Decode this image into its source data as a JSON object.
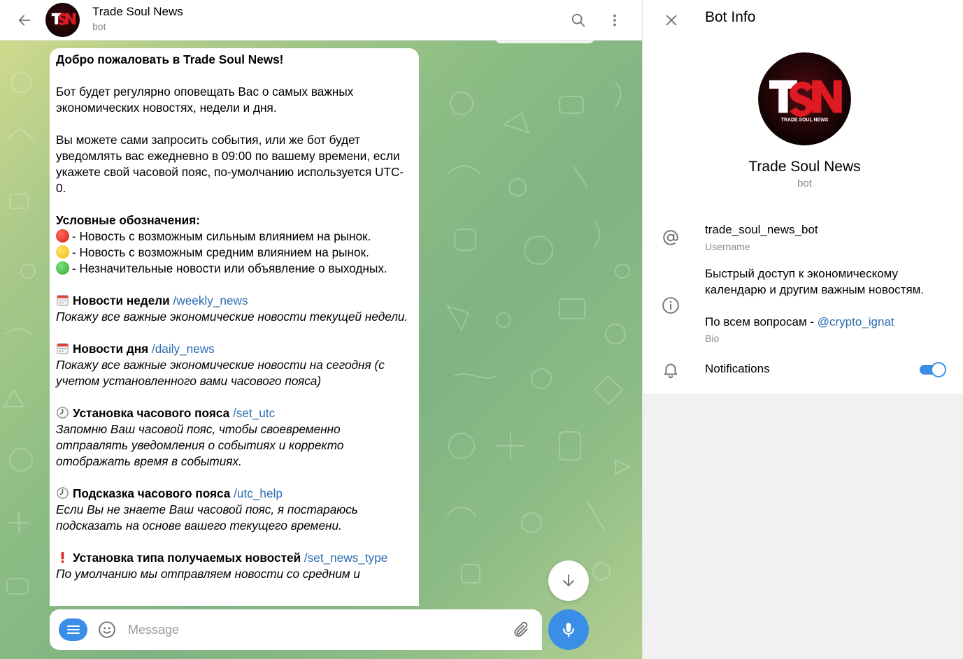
{
  "header": {
    "title": "Trade Soul News",
    "subtitle": "bot"
  },
  "message": {
    "welcome": "Добро пожаловать в Trade Soul News!",
    "intro": "Бот будет регулярно оповещать Вас о самых важных экономических новостях, недели и дня.",
    "schedule": "Вы можете сами запросить события, или же бот будет уведомлять вас ежедневно в 09:00 по вашему времени, если укажете свой часовой пояс, по-умолчанию используется UTC-0.",
    "legend_title": "Условные обозначения:",
    "legend_red": "- Новость с возможным сильным влиянием на рынок.",
    "legend_yellow": "- Новость с возможным средним влиянием на рынок.",
    "legend_green": "- Незначительные новости или объявление о выходных.",
    "commands": [
      {
        "title": "Новости недели",
        "cmd": "/weekly_news",
        "desc": "Покажу все важные экономические новости текущей недели."
      },
      {
        "title": "Новости дня",
        "cmd": "/daily_news",
        "desc": "Покажу все важные экономические новости на сегодня (с учетом установленного вами часового пояса)"
      },
      {
        "title": "Установка часового пояса",
        "cmd": "/set_utc",
        "desc": "Запомню Ваш часовой пояс, чтобы своевременно отправлять уведомления о событиях и корректо отображать время в событиях."
      },
      {
        "title": "Подсказка часового пояса",
        "cmd": "/utc_help",
        "desc": "Если Вы не знаете Ваш часовой пояс, я постараюсь подсказать на основе вашего текущего времени."
      },
      {
        "title": "Установка типа получаемых новостей",
        "cmd": "/set_news_type",
        "desc": "По умолчанию мы отправляем новости со средним и"
      }
    ],
    "icons": [
      "calendar-icon",
      "calendar-icon",
      "clock-icon",
      "clock-icon",
      "exclamation-icon"
    ]
  },
  "composer": {
    "placeholder": "Message"
  },
  "panel": {
    "title": "Bot Info",
    "bot_name": "Trade Soul News",
    "bot_type": "bot",
    "username": "trade_soul_news_bot",
    "username_label": "Username",
    "bio_text": "Быстрый доступ к экономическому календарю и другим важным новостям.",
    "bio_contact_prefix": "По всем вопросам - ",
    "bio_contact_link": "@crypto_ignat",
    "bio_label": "Bio",
    "notifications_label": "Notifications",
    "notifications_on": true
  },
  "logo": {
    "letters": "TSN",
    "tagline": "TRADE SOUL NEWS"
  },
  "colors": {
    "accent": "#3a8ee6",
    "link": "#2a6db2",
    "red_dot": "#e0281e",
    "yellow_dot": "#f2c21a",
    "green_dot": "#3fb34a",
    "logo_red": "#d9141c"
  }
}
